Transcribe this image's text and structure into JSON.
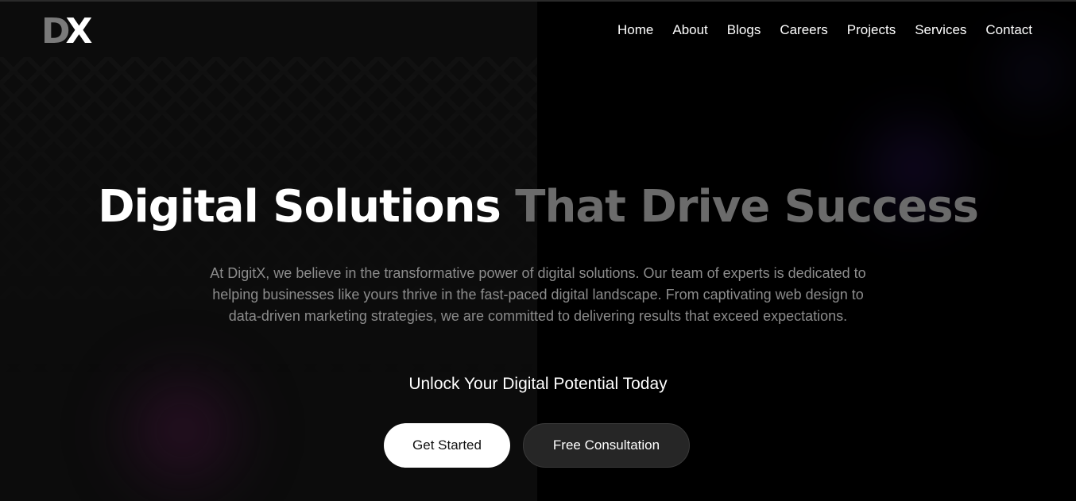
{
  "brand": {
    "logo_letter_1": "D",
    "logo_letter_2": "X",
    "logo_color_dim": "#7a7a7a",
    "logo_color_bright": "#ffffff"
  },
  "nav": {
    "items": [
      {
        "label": "Home"
      },
      {
        "label": "About"
      },
      {
        "label": "Blogs"
      },
      {
        "label": "Careers"
      },
      {
        "label": "Projects"
      },
      {
        "label": "Services"
      },
      {
        "label": "Contact"
      }
    ]
  },
  "hero": {
    "title_bright": "Digital Solutions",
    "title_dim": "That Drive Success",
    "description": "At DigitX, we believe in the transformative power of digital solutions. Our team of experts is dedicated to helping businesses like yours thrive in the fast-paced digital landscape. From captivating web design to data-driven marketing strategies, we are committed to delivering results that exceed expectations.",
    "tagline": "Unlock Your Digital Potential Today",
    "primary_button": "Get Started",
    "secondary_button": "Free Consultation"
  },
  "colors": {
    "background": "#000000",
    "title_dim": "#6b6b6b",
    "description": "#8c8c8c",
    "secondary_button_bg": "#262626"
  }
}
